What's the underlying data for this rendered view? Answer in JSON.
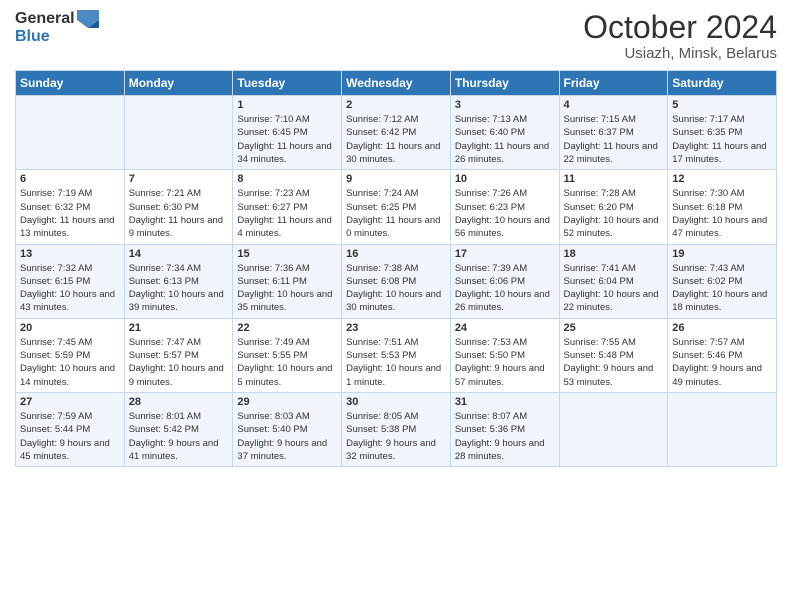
{
  "header": {
    "logo_line1": "General",
    "logo_line2": "Blue",
    "title": "October 2024",
    "subtitle": "Usiazh, Minsk, Belarus"
  },
  "days_of_week": [
    "Sunday",
    "Monday",
    "Tuesday",
    "Wednesday",
    "Thursday",
    "Friday",
    "Saturday"
  ],
  "weeks": [
    [
      {
        "day": "",
        "sunrise": "",
        "sunset": "",
        "daylight": ""
      },
      {
        "day": "",
        "sunrise": "",
        "sunset": "",
        "daylight": ""
      },
      {
        "day": "1",
        "sunrise": "Sunrise: 7:10 AM",
        "sunset": "Sunset: 6:45 PM",
        "daylight": "Daylight: 11 hours and 34 minutes."
      },
      {
        "day": "2",
        "sunrise": "Sunrise: 7:12 AM",
        "sunset": "Sunset: 6:42 PM",
        "daylight": "Daylight: 11 hours and 30 minutes."
      },
      {
        "day": "3",
        "sunrise": "Sunrise: 7:13 AM",
        "sunset": "Sunset: 6:40 PM",
        "daylight": "Daylight: 11 hours and 26 minutes."
      },
      {
        "day": "4",
        "sunrise": "Sunrise: 7:15 AM",
        "sunset": "Sunset: 6:37 PM",
        "daylight": "Daylight: 11 hours and 22 minutes."
      },
      {
        "day": "5",
        "sunrise": "Sunrise: 7:17 AM",
        "sunset": "Sunset: 6:35 PM",
        "daylight": "Daylight: 11 hours and 17 minutes."
      }
    ],
    [
      {
        "day": "6",
        "sunrise": "Sunrise: 7:19 AM",
        "sunset": "Sunset: 6:32 PM",
        "daylight": "Daylight: 11 hours and 13 minutes."
      },
      {
        "day": "7",
        "sunrise": "Sunrise: 7:21 AM",
        "sunset": "Sunset: 6:30 PM",
        "daylight": "Daylight: 11 hours and 9 minutes."
      },
      {
        "day": "8",
        "sunrise": "Sunrise: 7:23 AM",
        "sunset": "Sunset: 6:27 PM",
        "daylight": "Daylight: 11 hours and 4 minutes."
      },
      {
        "day": "9",
        "sunrise": "Sunrise: 7:24 AM",
        "sunset": "Sunset: 6:25 PM",
        "daylight": "Daylight: 11 hours and 0 minutes."
      },
      {
        "day": "10",
        "sunrise": "Sunrise: 7:26 AM",
        "sunset": "Sunset: 6:23 PM",
        "daylight": "Daylight: 10 hours and 56 minutes."
      },
      {
        "day": "11",
        "sunrise": "Sunrise: 7:28 AM",
        "sunset": "Sunset: 6:20 PM",
        "daylight": "Daylight: 10 hours and 52 minutes."
      },
      {
        "day": "12",
        "sunrise": "Sunrise: 7:30 AM",
        "sunset": "Sunset: 6:18 PM",
        "daylight": "Daylight: 10 hours and 47 minutes."
      }
    ],
    [
      {
        "day": "13",
        "sunrise": "Sunrise: 7:32 AM",
        "sunset": "Sunset: 6:15 PM",
        "daylight": "Daylight: 10 hours and 43 minutes."
      },
      {
        "day": "14",
        "sunrise": "Sunrise: 7:34 AM",
        "sunset": "Sunset: 6:13 PM",
        "daylight": "Daylight: 10 hours and 39 minutes."
      },
      {
        "day": "15",
        "sunrise": "Sunrise: 7:36 AM",
        "sunset": "Sunset: 6:11 PM",
        "daylight": "Daylight: 10 hours and 35 minutes."
      },
      {
        "day": "16",
        "sunrise": "Sunrise: 7:38 AM",
        "sunset": "Sunset: 6:08 PM",
        "daylight": "Daylight: 10 hours and 30 minutes."
      },
      {
        "day": "17",
        "sunrise": "Sunrise: 7:39 AM",
        "sunset": "Sunset: 6:06 PM",
        "daylight": "Daylight: 10 hours and 26 minutes."
      },
      {
        "day": "18",
        "sunrise": "Sunrise: 7:41 AM",
        "sunset": "Sunset: 6:04 PM",
        "daylight": "Daylight: 10 hours and 22 minutes."
      },
      {
        "day": "19",
        "sunrise": "Sunrise: 7:43 AM",
        "sunset": "Sunset: 6:02 PM",
        "daylight": "Daylight: 10 hours and 18 minutes."
      }
    ],
    [
      {
        "day": "20",
        "sunrise": "Sunrise: 7:45 AM",
        "sunset": "Sunset: 5:59 PM",
        "daylight": "Daylight: 10 hours and 14 minutes."
      },
      {
        "day": "21",
        "sunrise": "Sunrise: 7:47 AM",
        "sunset": "Sunset: 5:57 PM",
        "daylight": "Daylight: 10 hours and 9 minutes."
      },
      {
        "day": "22",
        "sunrise": "Sunrise: 7:49 AM",
        "sunset": "Sunset: 5:55 PM",
        "daylight": "Daylight: 10 hours and 5 minutes."
      },
      {
        "day": "23",
        "sunrise": "Sunrise: 7:51 AM",
        "sunset": "Sunset: 5:53 PM",
        "daylight": "Daylight: 10 hours and 1 minute."
      },
      {
        "day": "24",
        "sunrise": "Sunrise: 7:53 AM",
        "sunset": "Sunset: 5:50 PM",
        "daylight": "Daylight: 9 hours and 57 minutes."
      },
      {
        "day": "25",
        "sunrise": "Sunrise: 7:55 AM",
        "sunset": "Sunset: 5:48 PM",
        "daylight": "Daylight: 9 hours and 53 minutes."
      },
      {
        "day": "26",
        "sunrise": "Sunrise: 7:57 AM",
        "sunset": "Sunset: 5:46 PM",
        "daylight": "Daylight: 9 hours and 49 minutes."
      }
    ],
    [
      {
        "day": "27",
        "sunrise": "Sunrise: 7:59 AM",
        "sunset": "Sunset: 5:44 PM",
        "daylight": "Daylight: 9 hours and 45 minutes."
      },
      {
        "day": "28",
        "sunrise": "Sunrise: 8:01 AM",
        "sunset": "Sunset: 5:42 PM",
        "daylight": "Daylight: 9 hours and 41 minutes."
      },
      {
        "day": "29",
        "sunrise": "Sunrise: 8:03 AM",
        "sunset": "Sunset: 5:40 PM",
        "daylight": "Daylight: 9 hours and 37 minutes."
      },
      {
        "day": "30",
        "sunrise": "Sunrise: 8:05 AM",
        "sunset": "Sunset: 5:38 PM",
        "daylight": "Daylight: 9 hours and 32 minutes."
      },
      {
        "day": "31",
        "sunrise": "Sunrise: 8:07 AM",
        "sunset": "Sunset: 5:36 PM",
        "daylight": "Daylight: 9 hours and 28 minutes."
      },
      {
        "day": "",
        "sunrise": "",
        "sunset": "",
        "daylight": ""
      },
      {
        "day": "",
        "sunrise": "",
        "sunset": "",
        "daylight": ""
      }
    ]
  ]
}
